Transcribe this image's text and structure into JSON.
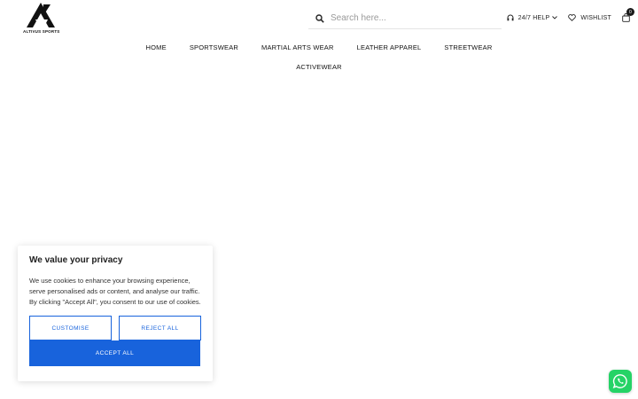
{
  "brand": {
    "logo_text": "ALTIVUS SPORTS"
  },
  "search": {
    "placeholder": "Search here..."
  },
  "header_actions": {
    "help_label": "24/7 HELP",
    "wishlist_label": "WISHLIST",
    "cart_count": "0"
  },
  "nav": {
    "row1": [
      "HOME",
      "SPORTSWEAR",
      "MARTIAL ARTS WEAR",
      "LEATHER APPAREL",
      "STREETWEAR"
    ],
    "row2": [
      "ACTIVEWEAR"
    ]
  },
  "cookie_banner": {
    "title": "We value your privacy",
    "text": "We use cookies to enhance your browsing experience, serve personalised ads or content, and analyse our traffic. By clicking \"Accept All\", you consent to our use of cookies.",
    "customise_label": "CUSTOMISE",
    "reject_label": "REJECT ALL",
    "accept_label": "ACCEPT ALL"
  },
  "colors": {
    "accent": "#1863dc",
    "whatsapp": "#25d366"
  },
  "icons": [
    "search-icon",
    "headset-icon",
    "chevron-down-icon",
    "heart-icon",
    "cart-icon",
    "whatsapp-icon"
  ]
}
